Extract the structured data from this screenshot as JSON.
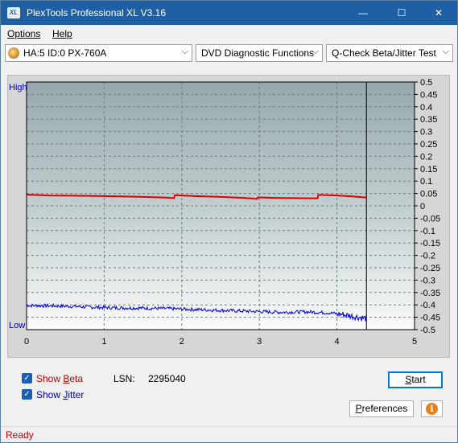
{
  "window": {
    "title": "PlexTools Professional XL V3.16",
    "icon_text": "XL",
    "minimize_glyph": "—",
    "maximize_glyph": "☐",
    "close_glyph": "✕"
  },
  "menu": [
    {
      "label": "Options"
    },
    {
      "label": "Help"
    }
  ],
  "toolbar": {
    "drive": "HA:5 ID:0  PX-760A",
    "function": "DVD Diagnostic Functions",
    "test": "Q-Check Beta/Jitter Test",
    "chevron": "⌵"
  },
  "chart_data": {
    "type": "line",
    "x_ticks": [
      "0",
      "1",
      "2",
      "3",
      "4",
      "5"
    ],
    "xlim": [
      0,
      5
    ],
    "y_right_ticks": [
      "0.5",
      "0.45",
      "0.4",
      "0.35",
      "0.3",
      "0.25",
      "0.2",
      "0.15",
      "0.1",
      "0.05",
      "0",
      "-0.05",
      "-0.1",
      "-0.15",
      "-0.2",
      "-0.25",
      "-0.3",
      "-0.35",
      "-0.4",
      "-0.45",
      "-0.5"
    ],
    "ylim": [
      -0.5,
      0.5
    ],
    "y_left_high": "High",
    "y_left_low": "Low",
    "grid": true,
    "end_marker_x": 4.38,
    "series": [
      {
        "name": "Beta",
        "color": "#dd0000",
        "x": [
          0,
          0.3,
          0.6,
          0.9,
          1.2,
          1.5,
          1.8,
          1.9,
          1.91,
          2.2,
          2.5,
          2.8,
          2.97,
          2.98,
          3.2,
          3.5,
          3.75,
          3.76,
          4.0,
          4.2,
          4.38
        ],
        "y": [
          0.045,
          0.042,
          0.041,
          0.04,
          0.038,
          0.036,
          0.033,
          0.031,
          0.043,
          0.039,
          0.036,
          0.032,
          0.028,
          0.034,
          0.032,
          0.031,
          0.03,
          0.044,
          0.042,
          0.038,
          0.033
        ]
      },
      {
        "name": "Jitter",
        "color": "#0000e0",
        "x": [
          0,
          0.3,
          0.6,
          0.9,
          1.2,
          1.5,
          1.8,
          2.1,
          2.4,
          2.7,
          3.0,
          3.3,
          3.6,
          3.9,
          4.1,
          4.25,
          4.38
        ],
        "y": [
          -0.402,
          -0.404,
          -0.406,
          -0.41,
          -0.412,
          -0.413,
          -0.415,
          -0.418,
          -0.421,
          -0.424,
          -0.427,
          -0.43,
          -0.428,
          -0.432,
          -0.44,
          -0.448,
          -0.455
        ]
      }
    ]
  },
  "controls": {
    "show_beta_prefix": "Show ",
    "show_beta_key": "B",
    "show_beta_rest": "eta",
    "show_jitter_prefix": "Show ",
    "show_jitter_key": "J",
    "show_jitter_rest": "itter",
    "lsn_label": "LSN:",
    "lsn_value": "2295040",
    "start_key": "S",
    "start_rest": "tart",
    "preferences_key": "P",
    "preferences_rest": "references",
    "info_glyph": "i",
    "check_glyph": "✓"
  },
  "status": {
    "text": "Ready"
  },
  "colors": {
    "beta_label": "#c00000",
    "jitter_label": "#0000c0",
    "axis_label_left": "#0000c0"
  }
}
